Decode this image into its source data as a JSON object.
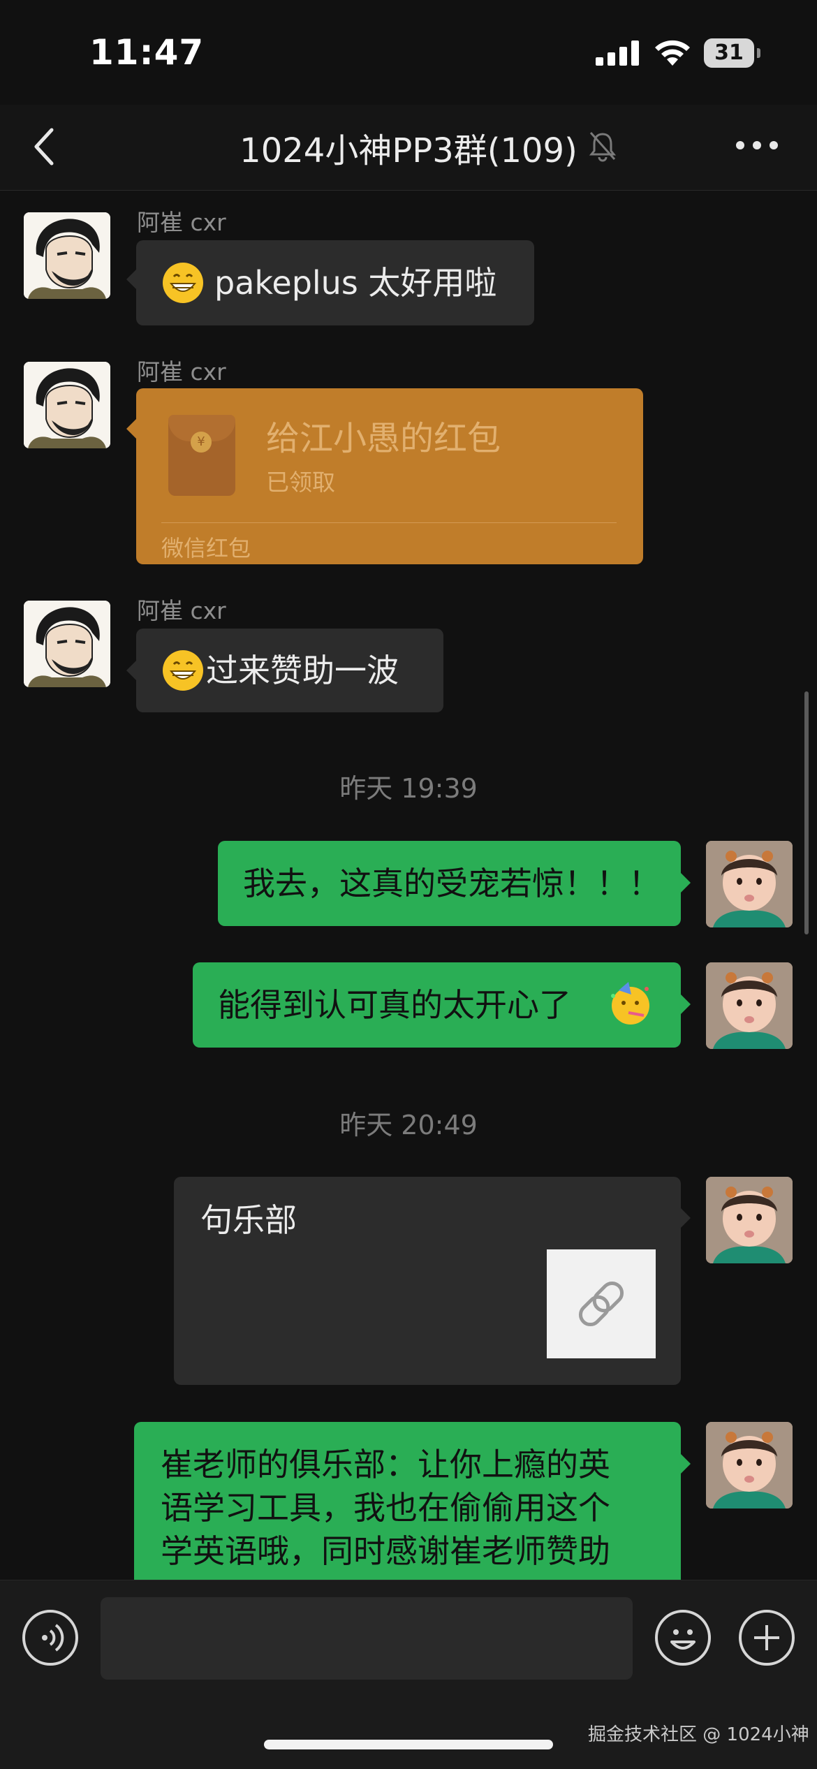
{
  "status": {
    "time": "11:47",
    "battery": "31"
  },
  "nav": {
    "title": "1024小神PP3群(109)",
    "muted": true
  },
  "messages": {
    "m1": {
      "sender": "阿崔 cxr",
      "text": "pakeplus 太好用啦"
    },
    "m2": {
      "sender": "阿崔 cxr",
      "packet_title": "给江小愚的红包",
      "packet_status": "已领取",
      "packet_footer": "微信红包"
    },
    "m3": {
      "sender": "阿崔 cxr",
      "text": "过来赞助一波"
    },
    "ts1": "昨天 19:39",
    "m4": {
      "text": "我去，这真的受宠若惊！！！"
    },
    "m5": {
      "text": "能得到认可真的太开心了"
    },
    "ts2": "昨天 20:49",
    "m6": {
      "title": "句乐部"
    },
    "m7": {
      "line1": "崔老师的俱乐部：让你上瘾的英",
      "line2": "语学习工具，我也在偷偷用这个",
      "line3": "学英语哦，同时感谢崔老师赞助"
    }
  },
  "footer": {
    "watermark": "掘金技术社区 @ 1024小神"
  },
  "colors": {
    "background": "#111111",
    "green_bubble": "#2aae55",
    "gray_bubble": "#2c2c2c",
    "red_packet": "#c07d2a"
  }
}
